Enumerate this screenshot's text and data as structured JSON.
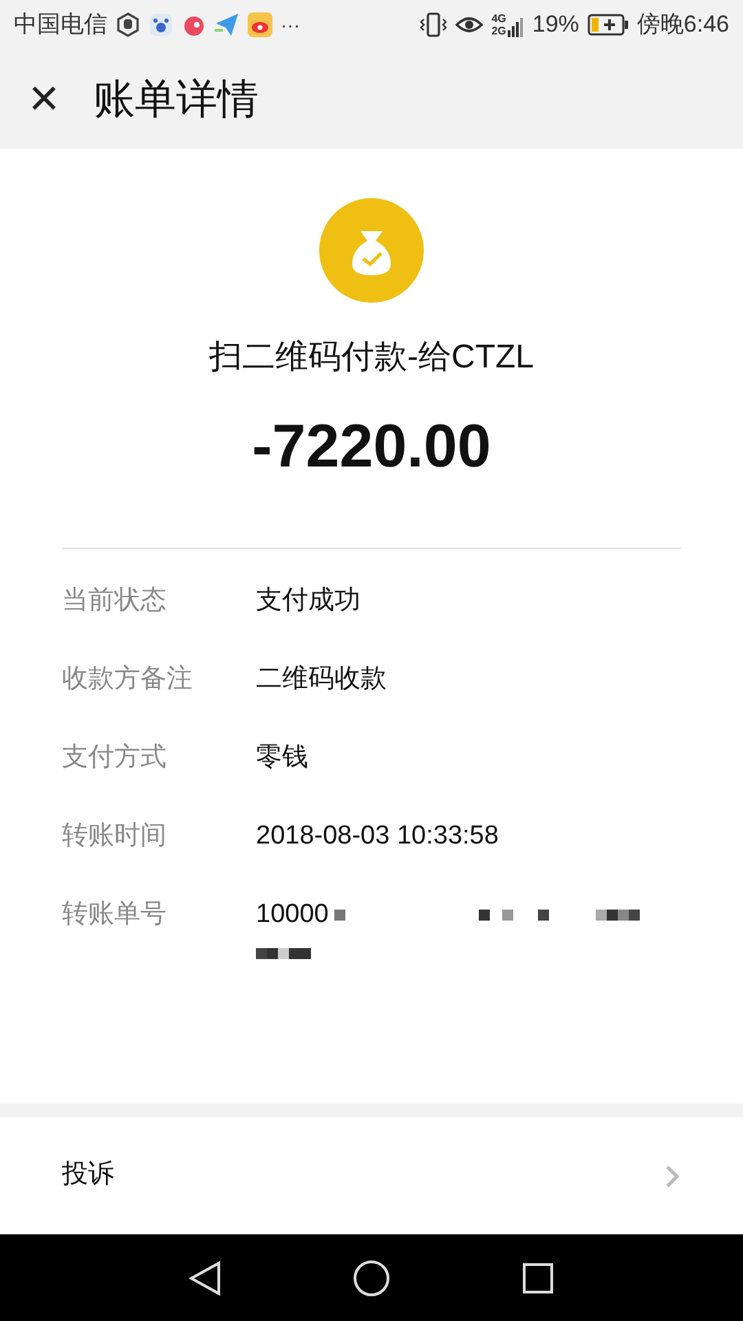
{
  "status_bar": {
    "carrier": "中国电信",
    "more": "···",
    "network_top": "4G",
    "network_bottom": "2G",
    "battery": "19%",
    "time": "傍晚6:46"
  },
  "header": {
    "close": "×",
    "title": "账单详情"
  },
  "summary": {
    "title": "扫二维码付款-给CTZL",
    "amount": "-7220.00"
  },
  "details": [
    {
      "label": "当前状态",
      "value": "支付成功"
    },
    {
      "label": "收款方备注",
      "value": "二维码收款"
    },
    {
      "label": "支付方式",
      "value": "零钱"
    },
    {
      "label": "转账时间",
      "value": "2018-08-03 10:33:58"
    },
    {
      "label": "转账单号",
      "value": "10000",
      "kind": "redacted"
    }
  ],
  "actions": [
    {
      "label": "投诉"
    }
  ]
}
